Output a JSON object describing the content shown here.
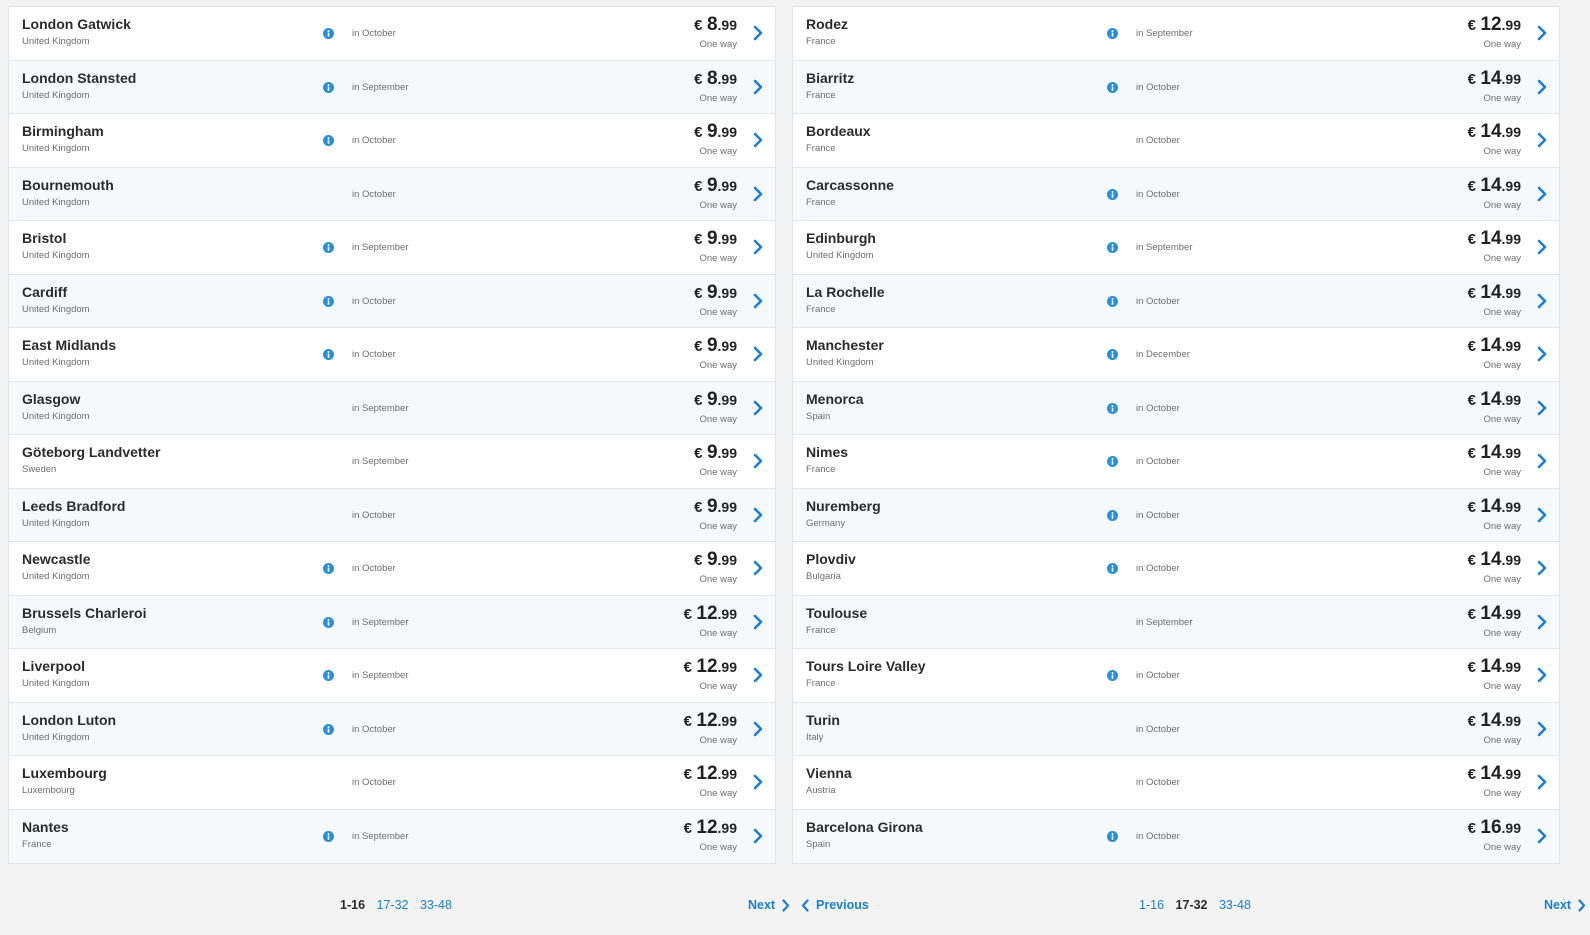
{
  "colors": {
    "accent": "#1b7fd0",
    "info": "#2a8fd6",
    "row_alt": "#f6f9fc"
  },
  "icons": {
    "info": "info-icon",
    "chevron": "chevron-right-icon",
    "back": "chevron-left-icon"
  },
  "left": {
    "rows": [
      {
        "city": "London Gatwick",
        "country": "United Kingdom",
        "info": true,
        "month": "in October",
        "currency": "€",
        "price_int": "8",
        "price_dec": ".99",
        "trip": "One way"
      },
      {
        "city": "London Stansted",
        "country": "United Kingdom",
        "info": true,
        "month": "in September",
        "currency": "€",
        "price_int": "8",
        "price_dec": ".99",
        "trip": "One way"
      },
      {
        "city": "Birmingham",
        "country": "United Kingdom",
        "info": true,
        "month": "in October",
        "currency": "€",
        "price_int": "9",
        "price_dec": ".99",
        "trip": "One way"
      },
      {
        "city": "Bournemouth",
        "country": "United Kingdom",
        "info": false,
        "month": "in October",
        "currency": "€",
        "price_int": "9",
        "price_dec": ".99",
        "trip": "One way"
      },
      {
        "city": "Bristol",
        "country": "United Kingdom",
        "info": true,
        "month": "in September",
        "currency": "€",
        "price_int": "9",
        "price_dec": ".99",
        "trip": "One way"
      },
      {
        "city": "Cardiff",
        "country": "United Kingdom",
        "info": true,
        "month": "in October",
        "currency": "€",
        "price_int": "9",
        "price_dec": ".99",
        "trip": "One way"
      },
      {
        "city": "East Midlands",
        "country": "United Kingdom",
        "info": true,
        "month": "in October",
        "currency": "€",
        "price_int": "9",
        "price_dec": ".99",
        "trip": "One way"
      },
      {
        "city": "Glasgow",
        "country": "United Kingdom",
        "info": false,
        "month": "in September",
        "currency": "€",
        "price_int": "9",
        "price_dec": ".99",
        "trip": "One way"
      },
      {
        "city": "Göteborg Landvetter",
        "country": "Sweden",
        "info": false,
        "month": "in September",
        "currency": "€",
        "price_int": "9",
        "price_dec": ".99",
        "trip": "One way"
      },
      {
        "city": "Leeds Bradford",
        "country": "United Kingdom",
        "info": false,
        "month": "in October",
        "currency": "€",
        "price_int": "9",
        "price_dec": ".99",
        "trip": "One way"
      },
      {
        "city": "Newcastle",
        "country": "United Kingdom",
        "info": true,
        "month": "in October",
        "currency": "€",
        "price_int": "9",
        "price_dec": ".99",
        "trip": "One way"
      },
      {
        "city": "Brussels Charleroi",
        "country": "Belgium",
        "info": true,
        "month": "in September",
        "currency": "€",
        "price_int": "12",
        "price_dec": ".99",
        "trip": "One way"
      },
      {
        "city": "Liverpool",
        "country": "United Kingdom",
        "info": true,
        "month": "in September",
        "currency": "€",
        "price_int": "12",
        "price_dec": ".99",
        "trip": "One way"
      },
      {
        "city": "London Luton",
        "country": "United Kingdom",
        "info": true,
        "month": "in October",
        "currency": "€",
        "price_int": "12",
        "price_dec": ".99",
        "trip": "One way"
      },
      {
        "city": "Luxembourg",
        "country": "Luxembourg",
        "info": false,
        "month": "in October",
        "currency": "€",
        "price_int": "12",
        "price_dec": ".99",
        "trip": "One way"
      },
      {
        "city": "Nantes",
        "country": "France",
        "info": true,
        "month": "in September",
        "currency": "€",
        "price_int": "12",
        "price_dec": ".99",
        "trip": "One way"
      }
    ],
    "pagination": {
      "pages": [
        "1-16",
        "17-32",
        "33-48"
      ],
      "current": "1-16",
      "next": "Next"
    }
  },
  "right": {
    "rows": [
      {
        "city": "Rodez",
        "country": "France",
        "info": true,
        "month": "in September",
        "currency": "€",
        "price_int": "12",
        "price_dec": ".99",
        "trip": "One way"
      },
      {
        "city": "Biarritz",
        "country": "France",
        "info": true,
        "month": "in October",
        "currency": "€",
        "price_int": "14",
        "price_dec": ".99",
        "trip": "One way"
      },
      {
        "city": "Bordeaux",
        "country": "France",
        "info": false,
        "month": "in October",
        "currency": "€",
        "price_int": "14",
        "price_dec": ".99",
        "trip": "One way"
      },
      {
        "city": "Carcassonne",
        "country": "France",
        "info": true,
        "month": "in October",
        "currency": "€",
        "price_int": "14",
        "price_dec": ".99",
        "trip": "One way"
      },
      {
        "city": "Edinburgh",
        "country": "United Kingdom",
        "info": true,
        "month": "in September",
        "currency": "€",
        "price_int": "14",
        "price_dec": ".99",
        "trip": "One way"
      },
      {
        "city": "La Rochelle",
        "country": "France",
        "info": true,
        "month": "in October",
        "currency": "€",
        "price_int": "14",
        "price_dec": ".99",
        "trip": "One way"
      },
      {
        "city": "Manchester",
        "country": "United Kingdom",
        "info": true,
        "month": "in December",
        "currency": "€",
        "price_int": "14",
        "price_dec": ".99",
        "trip": "One way"
      },
      {
        "city": "Menorca",
        "country": "Spain",
        "info": true,
        "month": "in October",
        "currency": "€",
        "price_int": "14",
        "price_dec": ".99",
        "trip": "One way"
      },
      {
        "city": "Nimes",
        "country": "France",
        "info": true,
        "month": "in October",
        "currency": "€",
        "price_int": "14",
        "price_dec": ".99",
        "trip": "One way"
      },
      {
        "city": "Nuremberg",
        "country": "Germany",
        "info": true,
        "month": "in October",
        "currency": "€",
        "price_int": "14",
        "price_dec": ".99",
        "trip": "One way"
      },
      {
        "city": "Plovdiv",
        "country": "Bulgaria",
        "info": true,
        "month": "in October",
        "currency": "€",
        "price_int": "14",
        "price_dec": ".99",
        "trip": "One way"
      },
      {
        "city": "Toulouse",
        "country": "France",
        "info": false,
        "month": "in September",
        "currency": "€",
        "price_int": "14",
        "price_dec": ".99",
        "trip": "One way"
      },
      {
        "city": "Tours Loire Valley",
        "country": "France",
        "info": true,
        "month": "in October",
        "currency": "€",
        "price_int": "14",
        "price_dec": ".99",
        "trip": "One way"
      },
      {
        "city": "Turin",
        "country": "Italy",
        "info": false,
        "month": "in October",
        "currency": "€",
        "price_int": "14",
        "price_dec": ".99",
        "trip": "One way"
      },
      {
        "city": "Vienna",
        "country": "Austria",
        "info": false,
        "month": "in October",
        "currency": "€",
        "price_int": "14",
        "price_dec": ".99",
        "trip": "One way"
      },
      {
        "city": "Barcelona Girona",
        "country": "Spain",
        "info": true,
        "month": "in October",
        "currency": "€",
        "price_int": "16",
        "price_dec": ".99",
        "trip": "One way"
      }
    ],
    "pagination": {
      "pages": [
        "1-16",
        "17-32",
        "33-48"
      ],
      "current": "17-32",
      "previous": "Previous",
      "next": "Next"
    }
  }
}
